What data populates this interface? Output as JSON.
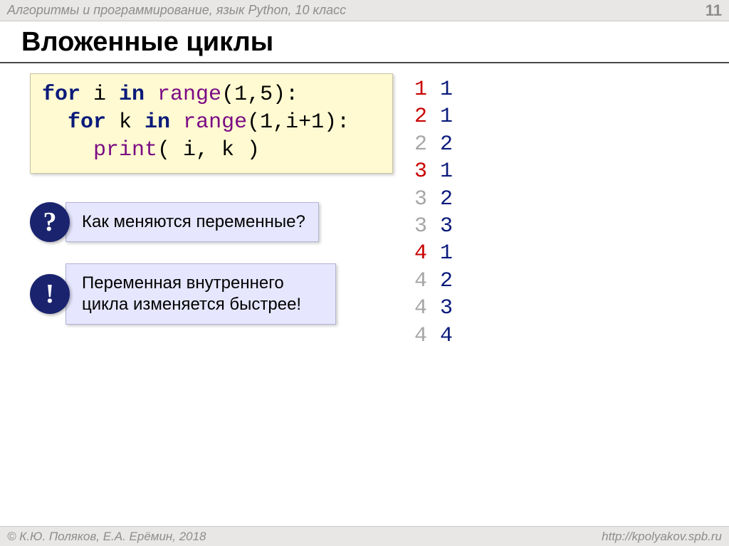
{
  "header": {
    "title": "Алгоритмы и программирование, язык Python, 10 класс",
    "page_number": "11"
  },
  "main_title": "Вложенные циклы",
  "code": {
    "line1_pre": "for",
    "line1_var": " i ",
    "line1_in": "in",
    "line1_fn": " range",
    "line1_args": "(1,5):",
    "line2_indent": "  ",
    "line2_pre": "for",
    "line2_var": " k ",
    "line2_in": "in",
    "line2_fn": " range",
    "line2_args": "(1,i+1):",
    "line3_indent": "    ",
    "line3_fn": "print",
    "line3_args": "( i, k )"
  },
  "callouts": {
    "question_symbol": "?",
    "question_text": "Как меняются переменные?",
    "excl_symbol": "!",
    "excl_text": "Переменная внутреннего цикла изменяется быстрее!"
  },
  "output": [
    {
      "i": "1",
      "k": "1",
      "first": true
    },
    {
      "i": "2",
      "k": "1",
      "first": true
    },
    {
      "i": "2",
      "k": "2",
      "first": false
    },
    {
      "i": "3",
      "k": "1",
      "first": true
    },
    {
      "i": "3",
      "k": "2",
      "first": false
    },
    {
      "i": "3",
      "k": "3",
      "first": false
    },
    {
      "i": "4",
      "k": "1",
      "first": true
    },
    {
      "i": "4",
      "k": "2",
      "first": false
    },
    {
      "i": "4",
      "k": "3",
      "first": false
    },
    {
      "i": "4",
      "k": "4",
      "first": false
    }
  ],
  "footer": {
    "copyright": "© К.Ю. Поляков, Е.А. Ерёмин, 2018",
    "url": "http://kpolyakov.spb.ru"
  }
}
